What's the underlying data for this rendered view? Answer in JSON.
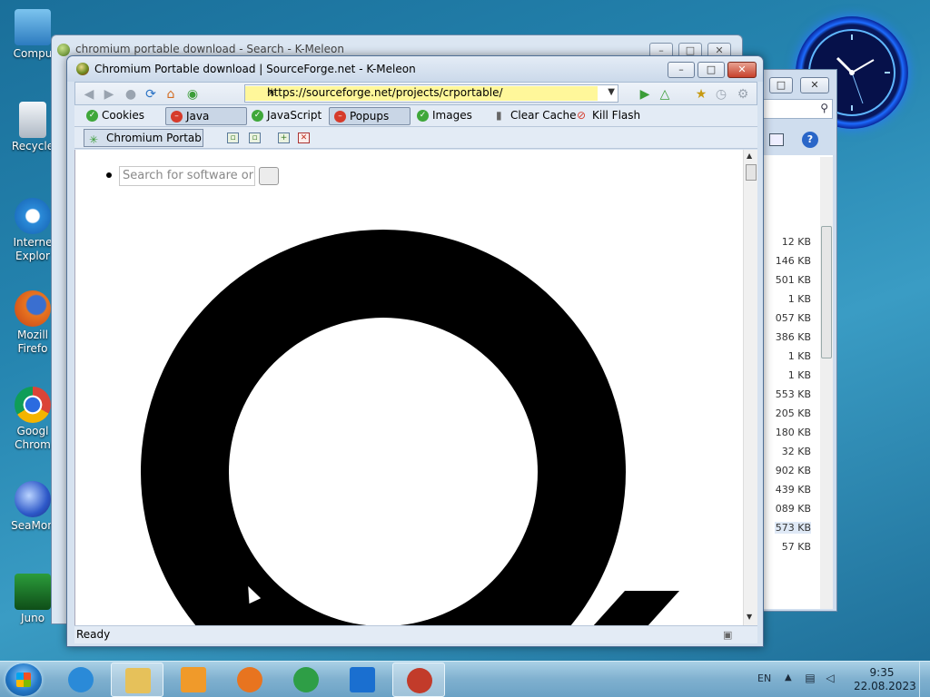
{
  "desktop": {
    "icons": [
      {
        "label": "Compu",
        "icon": "computer-icon",
        "color": "#4aa3df"
      },
      {
        "label": "Recycle",
        "icon": "recycle-bin-icon",
        "color": "#d8dde3"
      },
      {
        "label": "Interne Explor",
        "icon": "internet-explorer-icon",
        "color": "#2a8ad8"
      },
      {
        "label": "Mozill Firefo",
        "icon": "firefox-icon",
        "color": "#e8741f"
      },
      {
        "label": "Googl Chrom",
        "icon": "chrome-icon",
        "color": "#2e9e46"
      },
      {
        "label": "SeaMon",
        "icon": "seamonkey-icon",
        "color": "#2d58c8"
      },
      {
        "label": "Juno",
        "icon": "juno-icon",
        "color": "#1f7a2a"
      }
    ]
  },
  "background_window": {
    "title": "chromium portable download - Search - K-Meleon"
  },
  "explorer_window": {
    "sizes": [
      "12 KB",
      "146 KB",
      "501 KB",
      "1 KB",
      "057 KB",
      "386 KB",
      "1 KB",
      "1 KB",
      "553 KB",
      "205 KB",
      "180 KB",
      "32 KB",
      "902 KB",
      "439 KB",
      "089 KB",
      "573 KB",
      "57 KB"
    ]
  },
  "browser": {
    "title": "Chromium Portable download | SourceForge.net - K-Meleon",
    "url": "https://sourceforge.net/projects/crportable/",
    "toolbar": {
      "cookies": "Cookies",
      "java": "Java",
      "javascript": "JavaScript",
      "popups": "Popups",
      "images": "Images",
      "clear_cache": "Clear Cache",
      "kill_flash": "Kill Flash"
    },
    "tab_label": "Chromium Portab...",
    "page": {
      "search_placeholder": "Search for software or solutions"
    },
    "status": "Ready"
  },
  "taskbar": {
    "language": "EN",
    "time": "9:35",
    "date": "22.08.2023",
    "apps": [
      {
        "name": "internet-explorer-icon",
        "color": "#2a8ad8"
      },
      {
        "name": "file-explorer-icon",
        "color": "#e6c15a"
      },
      {
        "name": "media-player-icon",
        "color": "#f09a2a"
      },
      {
        "name": "firefox-icon",
        "color": "#e8741f"
      },
      {
        "name": "chrome-icon",
        "color": "#2e9e46"
      },
      {
        "name": "maxthon-icon",
        "color": "#1a6fd0"
      },
      {
        "name": "k-meleon-icon",
        "color": "#c23b2a"
      }
    ]
  },
  "colors": {
    "url_highlight": "#fff79a",
    "status_ok": "#3fa73a",
    "status_block": "#d63b2b"
  }
}
